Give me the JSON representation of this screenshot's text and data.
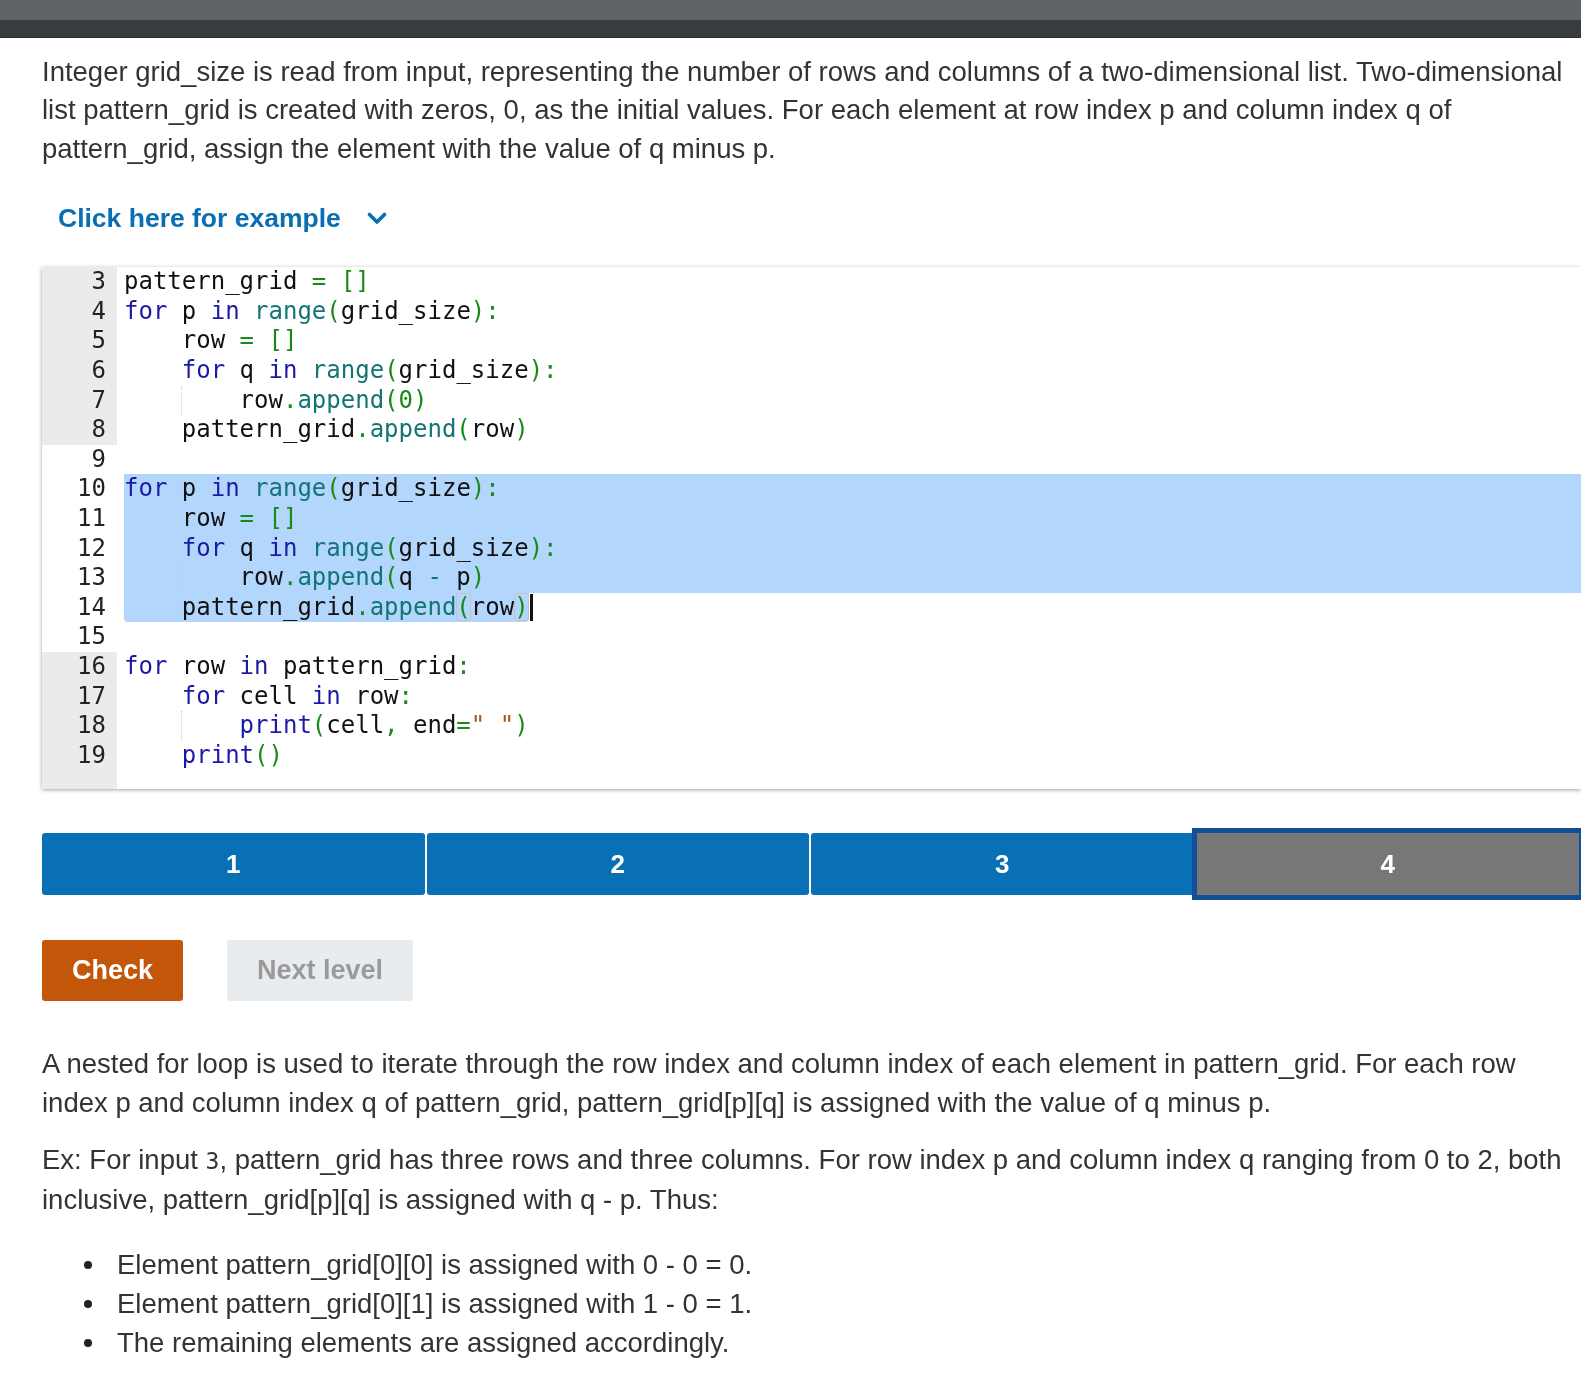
{
  "prompt": "Integer grid_size is read from input, representing the number of rows and columns of a two-dimensional list. Two-dimensional list pattern_grid is created with zeros, 0, as the initial values. For each element at row index p and column index q of pattern_grid, assign the element with the value of q minus p.",
  "example_toggle": {
    "label": "Click here for example",
    "expanded": false
  },
  "editor": {
    "lines": [
      {
        "number": "3",
        "readonly": true,
        "selected": false,
        "cursor": false,
        "indent_guide": false,
        "tokens": [
          {
            "kind": "plain",
            "text": "pattern_grid "
          },
          {
            "kind": "op",
            "text": "= []"
          }
        ]
      },
      {
        "number": "4",
        "readonly": true,
        "selected": false,
        "cursor": false,
        "indent_guide": false,
        "tokens": [
          {
            "kind": "kw",
            "text": "for"
          },
          {
            "kind": "plain",
            "text": " p "
          },
          {
            "kind": "kw",
            "text": "in"
          },
          {
            "kind": "fn",
            "text": " range"
          },
          {
            "kind": "op",
            "text": "("
          },
          {
            "kind": "plain",
            "text": "grid_size"
          },
          {
            "kind": "op",
            "text": "):"
          }
        ]
      },
      {
        "number": "5",
        "readonly": true,
        "selected": false,
        "cursor": false,
        "indent_guide": false,
        "tokens": [
          {
            "kind": "plain",
            "text": "    row "
          },
          {
            "kind": "op",
            "text": "= []"
          }
        ]
      },
      {
        "number": "6",
        "readonly": true,
        "selected": false,
        "cursor": false,
        "indent_guide": false,
        "tokens": [
          {
            "kind": "kw",
            "text": "    for"
          },
          {
            "kind": "plain",
            "text": " q "
          },
          {
            "kind": "kw",
            "text": "in"
          },
          {
            "kind": "fn",
            "text": " range"
          },
          {
            "kind": "op",
            "text": "("
          },
          {
            "kind": "plain",
            "text": "grid_size"
          },
          {
            "kind": "op",
            "text": "):"
          }
        ]
      },
      {
        "number": "7",
        "readonly": true,
        "selected": false,
        "cursor": false,
        "indent_guide": true,
        "tokens": [
          {
            "kind": "plain",
            "text": "        row"
          },
          {
            "kind": "op",
            "text": "."
          },
          {
            "kind": "fn",
            "text": "append"
          },
          {
            "kind": "op",
            "text": "("
          },
          {
            "kind": "num",
            "text": "0"
          },
          {
            "kind": "op",
            "text": ")"
          }
        ]
      },
      {
        "number": "8",
        "readonly": true,
        "selected": false,
        "cursor": false,
        "indent_guide": false,
        "tokens": [
          {
            "kind": "plain",
            "text": "    pattern_grid"
          },
          {
            "kind": "op",
            "text": "."
          },
          {
            "kind": "fn",
            "text": "append"
          },
          {
            "kind": "op",
            "text": "("
          },
          {
            "kind": "plain",
            "text": "row"
          },
          {
            "kind": "op",
            "text": ")"
          }
        ]
      },
      {
        "number": "9",
        "readonly": false,
        "selected": false,
        "cursor": false,
        "indent_guide": false
      },
      {
        "number": "10",
        "readonly": false,
        "selected": true,
        "cursor": false,
        "indent_guide": false,
        "tokens": [
          {
            "kind": "kw",
            "text": "for"
          },
          {
            "kind": "plain",
            "text": " p "
          },
          {
            "kind": "kw",
            "text": "in"
          },
          {
            "kind": "fn",
            "text": " range"
          },
          {
            "kind": "op",
            "text": "("
          },
          {
            "kind": "plain",
            "text": "grid_size"
          },
          {
            "kind": "op",
            "text": "):"
          }
        ]
      },
      {
        "number": "11",
        "readonly": false,
        "selected": true,
        "cursor": false,
        "indent_guide": false,
        "tokens": [
          {
            "kind": "plain",
            "text": "    row "
          },
          {
            "kind": "op",
            "text": "= []"
          }
        ]
      },
      {
        "number": "12",
        "readonly": false,
        "selected": true,
        "cursor": false,
        "indent_guide": false,
        "tokens": [
          {
            "kind": "kw",
            "text": "    for"
          },
          {
            "kind": "plain",
            "text": " q "
          },
          {
            "kind": "kw",
            "text": "in"
          },
          {
            "kind": "fn",
            "text": " range"
          },
          {
            "kind": "op",
            "text": "("
          },
          {
            "kind": "plain",
            "text": "grid_size"
          },
          {
            "kind": "op",
            "text": "):"
          }
        ]
      },
      {
        "number": "13",
        "readonly": false,
        "selected": true,
        "cursor": false,
        "indent_guide": true,
        "tokens": [
          {
            "kind": "plain",
            "text": "        row"
          },
          {
            "kind": "op",
            "text": "."
          },
          {
            "kind": "fn",
            "text": "append"
          },
          {
            "kind": "op",
            "text": "("
          },
          {
            "kind": "plain",
            "text": "q "
          },
          {
            "kind": "fn",
            "text": "-"
          },
          {
            "kind": "plain",
            "text": " p"
          },
          {
            "kind": "op",
            "text": ")"
          }
        ]
      },
      {
        "number": "14",
        "readonly": false,
        "selected": true,
        "cursor": true,
        "indent_guide": false,
        "tokens": [
          {
            "kind": "plain",
            "text": "    pattern_grid"
          },
          {
            "kind": "op",
            "text": "."
          },
          {
            "kind": "fn",
            "text": "append"
          },
          {
            "kind": "match",
            "text": "("
          },
          {
            "kind": "plain",
            "text": "row"
          },
          {
            "kind": "match",
            "text": ")"
          }
        ]
      },
      {
        "number": "15",
        "readonly": false,
        "selected": false,
        "cursor": false,
        "indent_guide": false
      },
      {
        "number": "16",
        "readonly": true,
        "selected": false,
        "cursor": false,
        "indent_guide": false,
        "tokens": [
          {
            "kind": "kw",
            "text": "for"
          },
          {
            "kind": "plain",
            "text": " row "
          },
          {
            "kind": "kw",
            "text": "in"
          },
          {
            "kind": "plain",
            "text": " pattern_grid"
          },
          {
            "kind": "op",
            "text": ":"
          }
        ]
      },
      {
        "number": "17",
        "readonly": true,
        "selected": false,
        "cursor": false,
        "indent_guide": false,
        "tokens": [
          {
            "kind": "kw",
            "text": "    for"
          },
          {
            "kind": "plain",
            "text": " cell "
          },
          {
            "kind": "kw",
            "text": "in"
          },
          {
            "kind": "plain",
            "text": " row"
          },
          {
            "kind": "op",
            "text": ":"
          }
        ]
      },
      {
        "number": "18",
        "readonly": true,
        "selected": false,
        "cursor": false,
        "indent_guide": true,
        "tokens": [
          {
            "kind": "builtin",
            "text": "        print"
          },
          {
            "kind": "op",
            "text": "("
          },
          {
            "kind": "plain",
            "text": "cell"
          },
          {
            "kind": "op",
            "text": ","
          },
          {
            "kind": "plain",
            "text": " end"
          },
          {
            "kind": "op",
            "text": "="
          },
          {
            "kind": "str",
            "text": "\" \""
          },
          {
            "kind": "op",
            "text": ")"
          }
        ]
      },
      {
        "number": "19",
        "readonly": true,
        "selected": false,
        "cursor": false,
        "indent_guide": false,
        "tokens": [
          {
            "kind": "builtin",
            "text": "    print"
          },
          {
            "kind": "op",
            "text": "()"
          }
        ]
      }
    ]
  },
  "levels": [
    {
      "label": "1",
      "done": true,
      "selected": false
    },
    {
      "label": "2",
      "done": true,
      "selected": false
    },
    {
      "label": "3",
      "done": true,
      "selected": false
    },
    {
      "label": "4",
      "done": false,
      "selected": true
    }
  ],
  "buttons": [
    {
      "label": "Check",
      "kind": "check",
      "disabled": false
    },
    {
      "label": "Next level",
      "kind": "next",
      "disabled": true
    }
  ],
  "explanation": [
    {
      "parts": [
        {
          "kind": "text",
          "text": "A nested for loop is used to iterate through the row index and column index of each element in pattern_grid. For each row index p and column index q of pattern_grid, pattern_grid[p][q] is assigned with the value of q minus p."
        }
      ]
    },
    {
      "parts": [
        {
          "kind": "text",
          "text": "Ex: For input "
        },
        {
          "kind": "code",
          "text": "3"
        },
        {
          "kind": "text",
          "text": ", pattern_grid has three rows and three columns. For row index p and column index q ranging from 0 to 2, both inclusive, pattern_grid[p][q] is assigned with q - p. Thus:"
        }
      ]
    }
  ],
  "bullets": [
    "Element pattern_grid[0][0] is assigned with 0 - 0 = 0.",
    "Element pattern_grid[0][1] is assigned with 1 - 0 = 1.",
    "The remaining elements are assigned accordingly."
  ]
}
